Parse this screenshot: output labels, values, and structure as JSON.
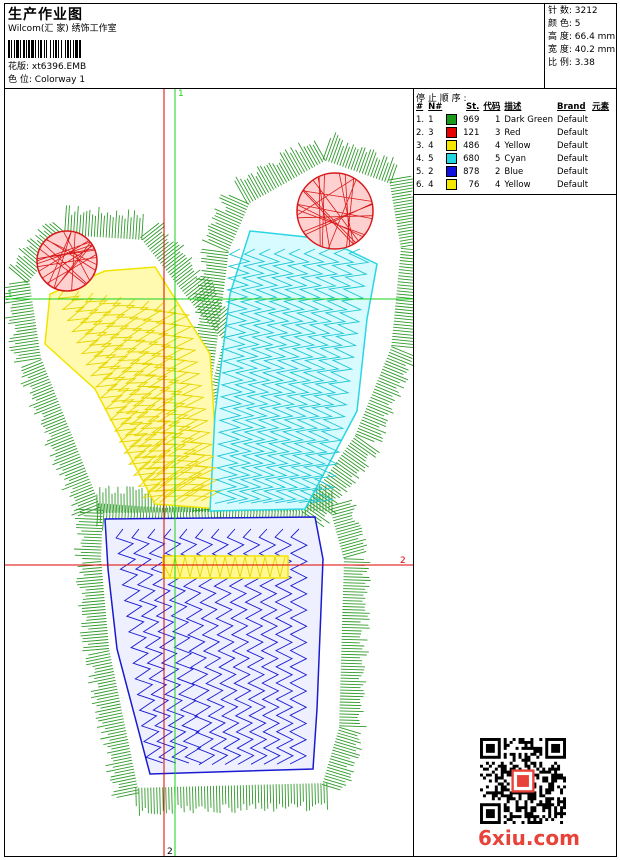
{
  "header": {
    "title": "生产作业图",
    "company": "Wilcom(汇 家) 绣饰工作室",
    "design_label": "花版:",
    "design_value": "xt6396.EMB",
    "colorway_label": "色 位:",
    "colorway_value": "Colorway 1"
  },
  "stats": {
    "stitches": "针 数: 3212",
    "colors": "颜 色: 5",
    "height": "高 度: 66.4 mm",
    "width": "宽 度: 40.2 mm",
    "scale": "比 例: 3.38"
  },
  "stop_sequence": {
    "title": "停 止 顺 序 :",
    "columns": [
      "#",
      "N#",
      "St.",
      "代码",
      "描述",
      "Brand",
      "元素"
    ],
    "rows": [
      {
        "idx": "1.",
        "n": "1",
        "color": "#1a9a1a",
        "st": "969",
        "code": "1",
        "desc": "Dark Green",
        "brand": "Default"
      },
      {
        "idx": "2.",
        "n": "3",
        "color": "#e80000",
        "st": "121",
        "code": "3",
        "desc": "Red",
        "brand": "Default"
      },
      {
        "idx": "3.",
        "n": "4",
        "color": "#f5e600",
        "st": "486",
        "code": "4",
        "desc": "Yellow",
        "brand": "Default"
      },
      {
        "idx": "4.",
        "n": "5",
        "color": "#22d8e0",
        "st": "680",
        "code": "5",
        "desc": "Cyan",
        "brand": "Default"
      },
      {
        "idx": "5.",
        "n": "2",
        "color": "#1010e0",
        "st": "878",
        "code": "2",
        "desc": "Blue",
        "brand": "Default"
      },
      {
        "idx": "6.",
        "n": "4",
        "color": "#f5e600",
        "st": "76",
        "code": "4",
        "desc": "Yellow",
        "brand": "Default"
      }
    ]
  },
  "axes": {
    "v1": "1",
    "h1": "1",
    "v2": "2",
    "h2": "2"
  },
  "watermark": "6xiu.com",
  "colors": {
    "green": "#2f9a2a",
    "red": "#d81818",
    "yellow": "#f2e400",
    "cyan": "#2ad6e4",
    "blue": "#1a1ad0"
  }
}
